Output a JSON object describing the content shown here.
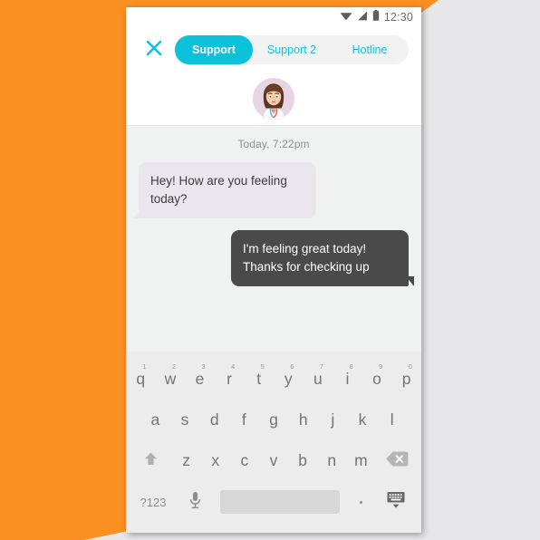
{
  "background": {
    "orange_hex": "#fb9022",
    "page_hex": "#e7e7e9"
  },
  "statusbar": {
    "wifi_icon": "wifi-icon",
    "signal_icon": "cellular-signal-icon",
    "battery_icon": "battery-icon",
    "time": "12:30"
  },
  "header": {
    "close_icon": "close-icon",
    "tabs": [
      {
        "label": "Support",
        "active": true
      },
      {
        "label": "Support 2",
        "active": false
      },
      {
        "label": "Hotline",
        "active": false
      }
    ],
    "accent_hex": "#0cc2da",
    "avatar": "agent-avatar"
  },
  "chat": {
    "date_label": "Today, 7:22pm",
    "messages": [
      {
        "side": "in",
        "text": "Hey! How are you feeling today?"
      },
      {
        "side": "out",
        "text": "I'm feeling great today! Thanks for checking up"
      }
    ],
    "incoming_bubble_hex": "#e9e7ed",
    "outgoing_bubble_hex": "#4a4a4a",
    "background_hex": "#eff2f1"
  },
  "keyboard": {
    "row1": [
      {
        "key": "q",
        "num": "1"
      },
      {
        "key": "w",
        "num": "2"
      },
      {
        "key": "e",
        "num": "3"
      },
      {
        "key": "r",
        "num": "4"
      },
      {
        "key": "t",
        "num": "5"
      },
      {
        "key": "y",
        "num": "6"
      },
      {
        "key": "u",
        "num": "7"
      },
      {
        "key": "i",
        "num": "8"
      },
      {
        "key": "o",
        "num": "9"
      },
      {
        "key": "p",
        "num": "0"
      }
    ],
    "row2": [
      {
        "key": "a"
      },
      {
        "key": "s"
      },
      {
        "key": "d"
      },
      {
        "key": "f"
      },
      {
        "key": "g"
      },
      {
        "key": "h"
      },
      {
        "key": "j"
      },
      {
        "key": "k"
      },
      {
        "key": "l"
      }
    ],
    "row3": [
      {
        "key": "z"
      },
      {
        "key": "x"
      },
      {
        "key": "c"
      },
      {
        "key": "v"
      },
      {
        "key": "b"
      },
      {
        "key": "n"
      },
      {
        "key": "m"
      }
    ],
    "shift_icon": "shift-arrow-icon",
    "backspace_icon": "backspace-icon",
    "symbols_label": "?123",
    "mic_icon": "microphone-icon",
    "space_label": "",
    "period_label": ".",
    "hide_keyboard_icon": "hide-keyboard-icon",
    "background_hex": "#ececec",
    "spacebar_hex": "#d7d7d7"
  }
}
